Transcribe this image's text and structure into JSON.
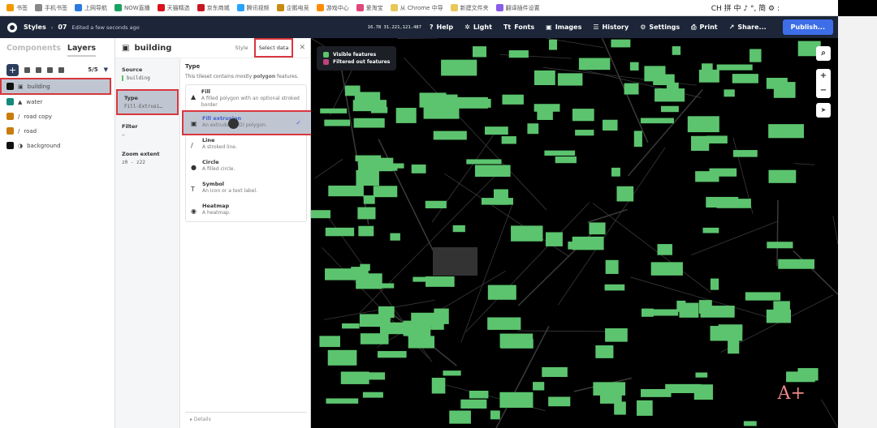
{
  "bookmarks": [
    "书签",
    "手机书签",
    "上网导航",
    "NOW直播",
    "天猫精选",
    "京东商城",
    "腾讯视频",
    "企鹅电竞",
    "游戏中心",
    "爱淘宝",
    "从 Chrome 中导",
    "新建文件夹",
    "翻译插件设置"
  ],
  "ime": "CH 拼 中 ♪ °, 简 ⚙ :",
  "topbar": {
    "app": "Styles",
    "style_name": "07",
    "status": "Edited a few seconds ago",
    "coords": "16.78 31.221,121.487",
    "buttons": [
      "Help",
      "Light",
      "Fonts",
      "Images",
      "History",
      "Settings",
      "Print",
      "Share..."
    ],
    "publish": "Publish..."
  },
  "left": {
    "tabs": [
      "Components",
      "Layers"
    ],
    "count": "5/5",
    "layers": [
      {
        "name": "building",
        "color": "#111111",
        "icon": "cube-icon"
      },
      {
        "name": "water",
        "color": "#138a7a",
        "icon": "fill-icon"
      },
      {
        "name": "road copy",
        "color": "#c97c0c",
        "icon": "line-icon"
      },
      {
        "name": "road",
        "color": "#c97c0c",
        "icon": "line-icon"
      },
      {
        "name": "background",
        "color": "#111111",
        "icon": "background-icon"
      }
    ]
  },
  "editor": {
    "title": "building",
    "tabs": [
      "Style",
      "Select data"
    ],
    "source_label": "Source",
    "source": "building",
    "type_label": "Type",
    "type_value": "Fill-Extrusi…",
    "filter_label": "Filter",
    "filter_value": "—",
    "zoom_label": "Zoom extent",
    "zoom_value": "z0 - z22",
    "type_heading": "Type",
    "type_desc_pre": "This tileset contains mostly ",
    "type_desc_bold": "polygon",
    "type_desc_post": " features.",
    "options": [
      {
        "name": "Fill",
        "desc": "A filled polygon with an optional stroked border",
        "icon": "▲"
      },
      {
        "name": "Fill extrusion",
        "desc": "An extruded (3D) polygon.",
        "icon": "▣",
        "selected": true
      },
      {
        "name": "Line",
        "desc": "A stroked line.",
        "icon": "/"
      },
      {
        "name": "Circle",
        "desc": "A filled circle.",
        "icon": "●"
      },
      {
        "name": "Symbol",
        "desc": "An icon or a text label.",
        "icon": "T"
      },
      {
        "name": "Heatmap",
        "desc": "A heatmap.",
        "icon": "◉"
      }
    ],
    "details": "Details"
  },
  "map": {
    "legend": [
      "Visible features",
      "Filtered out features"
    ],
    "visible_color": "#5cc46e",
    "filtered_color": "#c0437a",
    "watermark": "A+"
  }
}
